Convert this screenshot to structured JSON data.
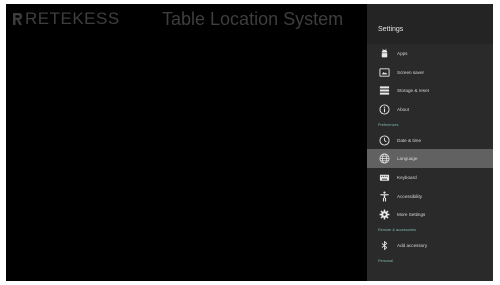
{
  "screen": {
    "brand": "RETEKESS",
    "system_title": "Table Location System"
  },
  "settings": {
    "title": "Settings",
    "items_top": [
      {
        "label": "Apps",
        "icon": "android-icon"
      },
      {
        "label": "Screen saver",
        "icon": "screen-icon"
      },
      {
        "label": "Storage & reset",
        "icon": "storage-icon"
      },
      {
        "label": "About",
        "icon": "info-icon"
      }
    ],
    "sections": {
      "preferences": "Preferences",
      "remote": "Remote & accessories",
      "personal": "Personal"
    },
    "items_pref": [
      {
        "label": "Date & time",
        "icon": "clock-icon"
      },
      {
        "label": "Language",
        "icon": "globe-icon",
        "selected": true
      },
      {
        "label": "Keyboard",
        "icon": "keyboard-icon"
      },
      {
        "label": "Accessibility",
        "icon": "accessibility-icon"
      },
      {
        "label": "More Settings",
        "icon": "gear-icon"
      }
    ],
    "items_remote": [
      {
        "label": "Add accessory",
        "icon": "bluetooth-icon"
      }
    ]
  },
  "colors": {
    "panel_bg": "#2a2a2a",
    "selected_bg": "#616161",
    "section_text": "#7fb7ae",
    "stage_bg": "#000000"
  }
}
